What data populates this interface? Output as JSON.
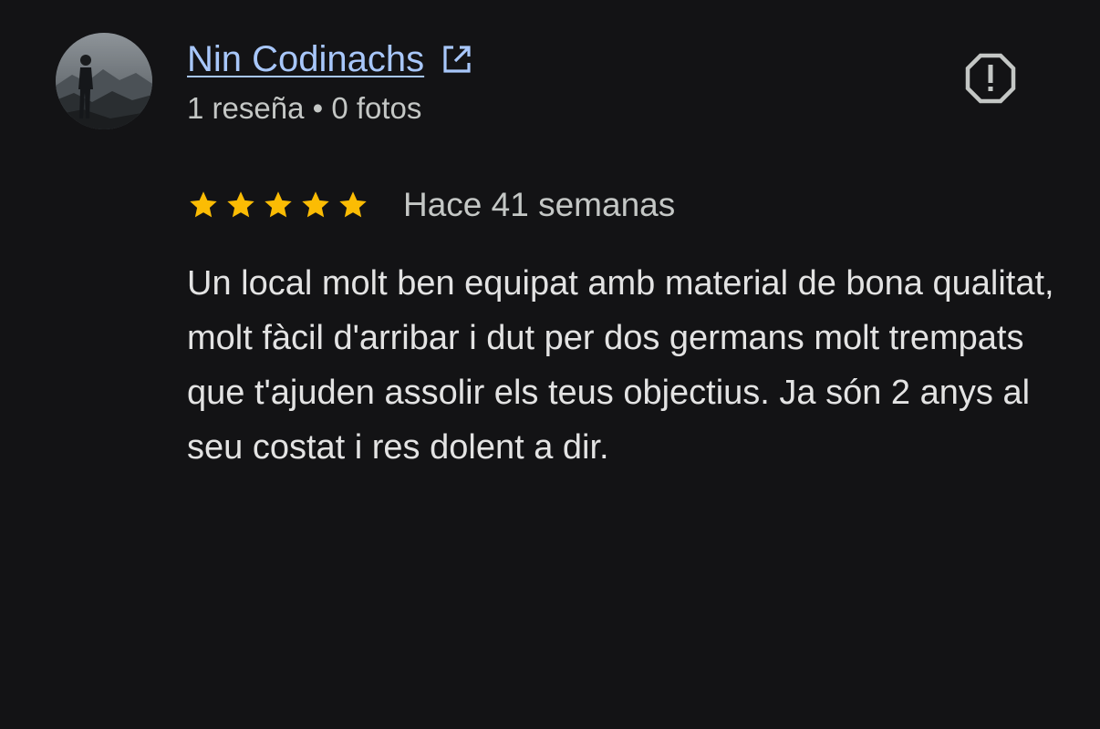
{
  "review": {
    "author_name": "Nin Codinachs",
    "author_meta": "1 reseña • 0 fotos",
    "rating": 5,
    "max_rating": 5,
    "time_ago": "Hace 41 semanas",
    "text": "Un local molt ben equipat amb material de bona qualitat, molt fàcil d'arribar i dut per dos germans molt trempats que t'ajuden assolir els teus objectius. Ja són 2 anys al seu costat i res dolent a dir."
  },
  "icons": {
    "open_profile": "open-in-new-icon",
    "report": "report-octagon-icon",
    "star": "star-icon"
  },
  "colors": {
    "background": "#131315",
    "link": "#a8c7fa",
    "secondary_text": "#c4c7c5",
    "body_text": "#e3e3e3",
    "star": "#fbbc04"
  }
}
